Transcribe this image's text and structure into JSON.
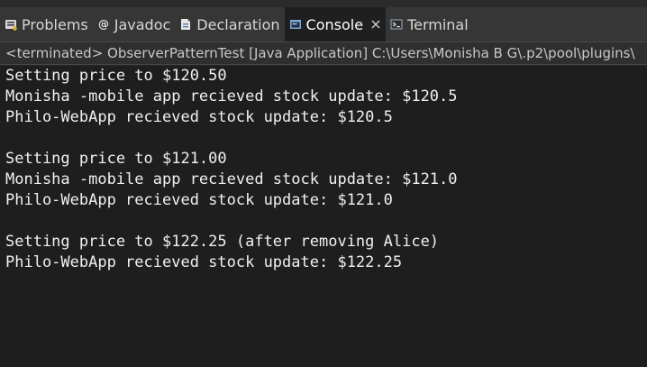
{
  "colors": {
    "tab_bar_bg": "#363636",
    "active_tab_bg": "#1f1f1f",
    "console_bg": "#1e1e1e",
    "console_text": "#f0f0f0"
  },
  "tabs": [
    {
      "label": "Problems",
      "icon": "problems-icon",
      "active": false
    },
    {
      "label": "Javadoc",
      "icon": "javadoc-at-icon",
      "active": false
    },
    {
      "label": "Declaration",
      "icon": "declaration-icon",
      "active": false
    },
    {
      "label": "Console",
      "icon": "console-icon",
      "active": true,
      "closable": true
    },
    {
      "label": "Terminal",
      "icon": "terminal-icon",
      "active": false
    }
  ],
  "status": {
    "text": "<terminated> ObserverPatternTest [Java Application] C:\\Users\\Monisha B G\\.p2\\pool\\plugins\\"
  },
  "console": {
    "lines": [
      "Setting price to $120.50",
      "Monisha -mobile app recieved stock update: $120.5",
      "Philo-WebApp recieved stock update: $120.5",
      "",
      "Setting price to $121.00",
      "Monisha -mobile app recieved stock update: $121.0",
      "Philo-WebApp recieved stock update: $121.0",
      "",
      "Setting price to $122.25 (after removing Alice)",
      "Philo-WebApp recieved stock update: $122.25"
    ]
  }
}
